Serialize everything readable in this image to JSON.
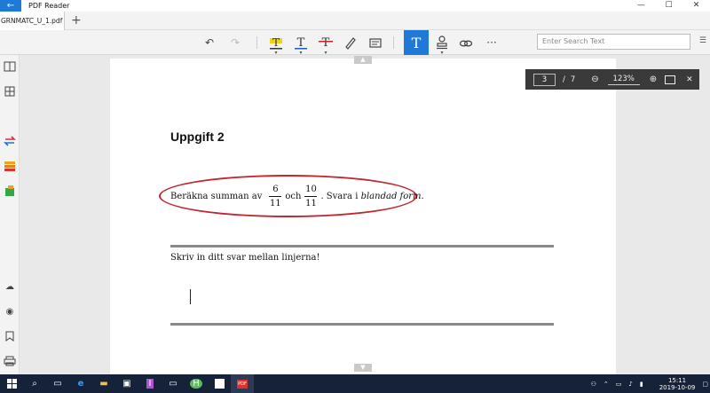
{
  "app": {
    "title": "PDF Reader"
  },
  "window": {
    "minimize": "—",
    "maximize": "☐",
    "close": "✕"
  },
  "tabs": [
    {
      "label": "GRNMATC_U_1.pdf",
      "close": "✕"
    }
  ],
  "search": {
    "placeholder": "Enter Search Text"
  },
  "document": {
    "heading": "Uppgift 2",
    "problem": {
      "prefix": "Beräkna summan av",
      "frac1_num": "6",
      "frac1_den": "11",
      "mid": "och",
      "frac2_num": "10",
      "frac2_den": "11",
      "suffix": ". Svara i ",
      "emph": "blandad form",
      "end": "."
    },
    "instruction": "Skriv in ditt svar mellan linjerna!"
  },
  "pagenav": {
    "current": "3",
    "separator": "/",
    "total": "7",
    "zoom": "123%"
  },
  "taskbar": {
    "time": "15:11",
    "date": "2019-10-09"
  },
  "colors": {
    "accent": "#1e7ad6",
    "annotation": "#c1272d",
    "taskbar": "#16213a"
  }
}
